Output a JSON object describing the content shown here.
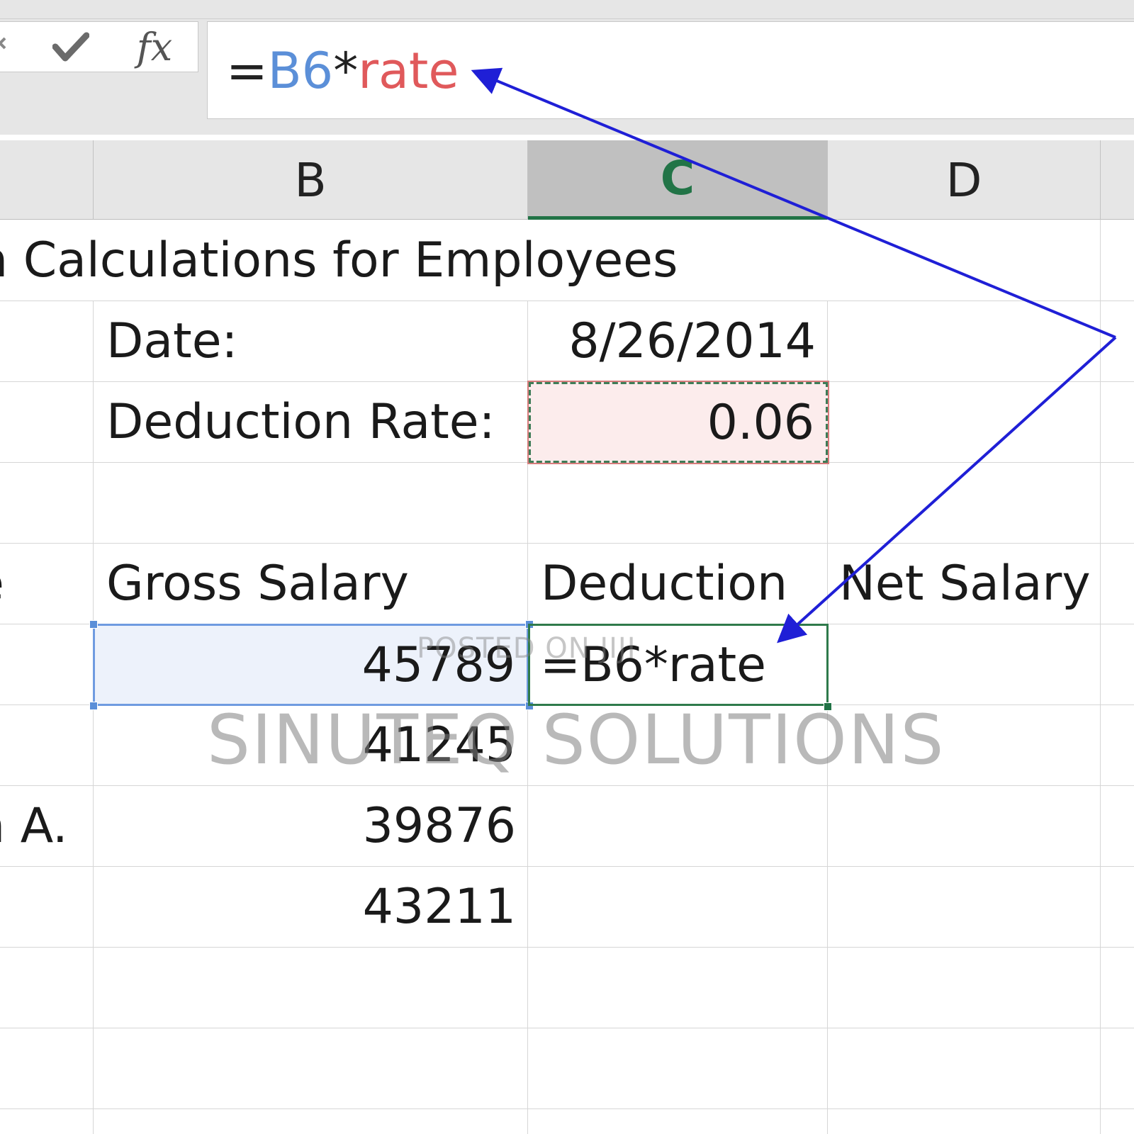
{
  "formula_bar": {
    "cancel_icon": "x-icon",
    "enter_icon": "checkmark-icon",
    "fx_label": "fx",
    "formula_eq": "=",
    "formula_ref": "B6",
    "formula_op": "*",
    "formula_name": "rate"
  },
  "columns": {
    "b": "B",
    "c": "C",
    "d": "D"
  },
  "sheet": {
    "title": "n Calculations for Employees",
    "date_label": "Date:",
    "date_value": "8/26/2014",
    "rate_label": "Deduction Rate:",
    "rate_value": "0.06",
    "col_a_header_fragment": "e",
    "gross_header": "Gross Salary",
    "deduction_header": "Deduction",
    "net_header": "Net Salary",
    "rows": [
      {
        "a": "",
        "gross": "45789",
        "deduction": "=B6*rate"
      },
      {
        "a": "",
        "gross": "41245",
        "deduction": ""
      },
      {
        "a": "n A.",
        "gross": "39876",
        "deduction": ""
      },
      {
        "a": "",
        "gross": "43211",
        "deduction": ""
      }
    ]
  },
  "watermark": {
    "main": "SINUTEQ SOLUTIONS",
    "small": "POSTED ON JIJI"
  },
  "colors": {
    "arrow": "#1f1fd6",
    "active_column": "#217346",
    "reference_blue": "#5b8fd8",
    "name_red": "#e0595b"
  }
}
